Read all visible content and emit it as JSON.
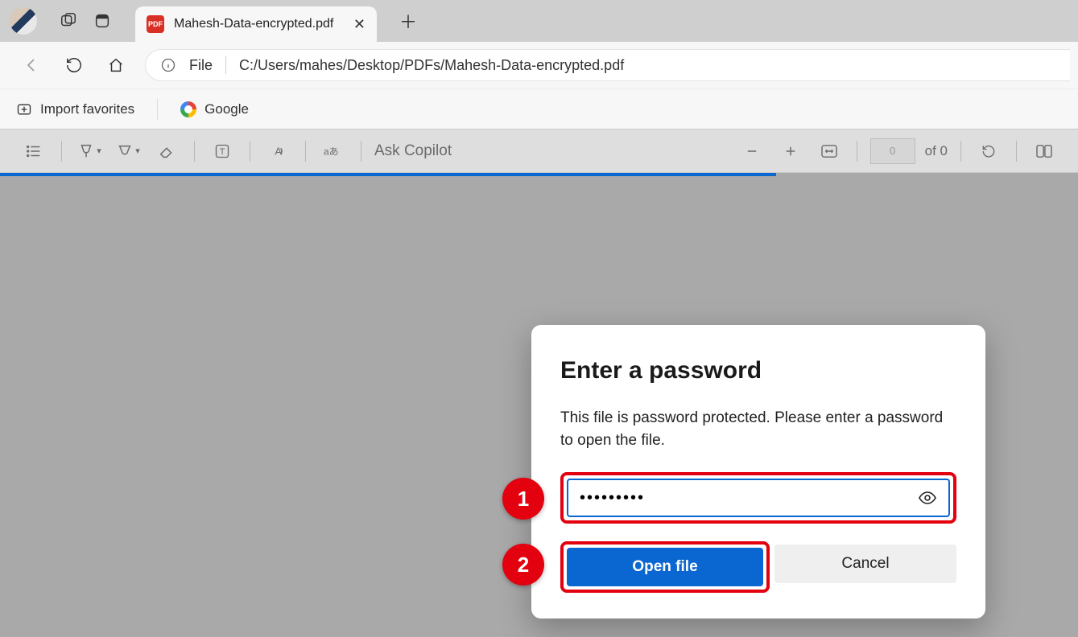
{
  "tab": {
    "title": "Mahesh-Data-encrypted.pdf",
    "badge": "PDF"
  },
  "address": {
    "scheme": "File",
    "path": "C:/Users/mahes/Desktop/PDFs/Mahesh-Data-encrypted.pdf"
  },
  "bookmarks": {
    "import": "Import favorites",
    "google": "Google"
  },
  "pdfbar": {
    "copilot": "Ask Copilot",
    "page_value": "0",
    "page_total": "of 0"
  },
  "dialog": {
    "title": "Enter a password",
    "body": "This file is password protected. Please enter a password to open the file.",
    "password_masked": "•••••••••",
    "open": "Open file",
    "cancel": "Cancel"
  },
  "annotations": {
    "one": "1",
    "two": "2"
  }
}
